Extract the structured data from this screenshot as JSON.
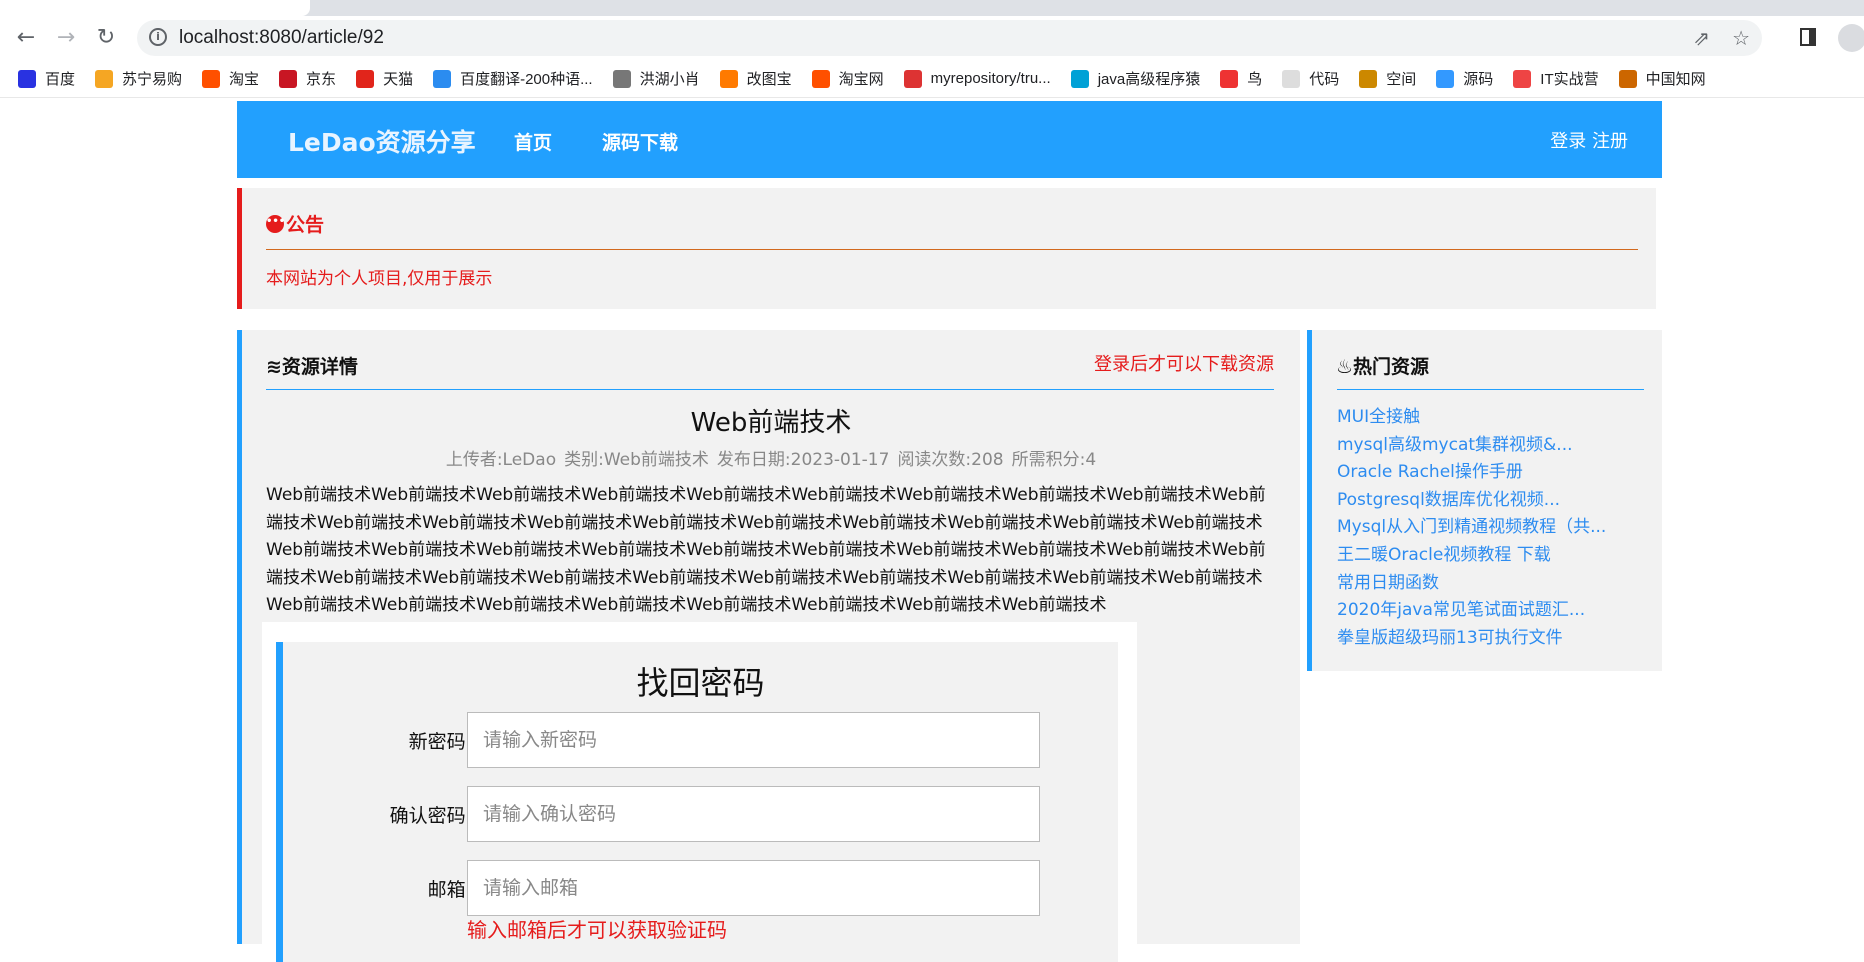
{
  "browser": {
    "url": "localhost:8080/article/92",
    "bookmarks": [
      "百度",
      "苏宁易购",
      "淘宝",
      "京东",
      "天猫",
      "百度翻译-200种语...",
      "洪湖小肖",
      "改图宝",
      "淘宝网",
      "myrepository/tru...",
      "java高级程序猿",
      "鸟",
      "代码",
      "空间",
      "源码",
      "IT实战营",
      "中国知网"
    ]
  },
  "header": {
    "logo": "LeDao资源分享",
    "nav": [
      "首页",
      "源码下载"
    ],
    "auth": "登录 注册"
  },
  "notice": {
    "title": "公告",
    "text": "本网站为个人项目,仅用于展示"
  },
  "article": {
    "section_title": "资源详情",
    "download_hint": "登录后才可以下载资源",
    "title": "Web前端技术",
    "meta": {
      "uploader": "上传者:LeDao",
      "category": "类别:Web前端技术",
      "date": "发布日期:2023-01-17",
      "views": "阅读次数:208",
      "points": "所需积分:4"
    },
    "body": "Web前端技术Web前端技术Web前端技术Web前端技术Web前端技术Web前端技术Web前端技术Web前端技术Web前端技术Web前端技术Web前端技术Web前端技术Web前端技术Web前端技术Web前端技术Web前端技术Web前端技术Web前端技术Web前端技术Web前端技术Web前端技术Web前端技术Web前端技术Web前端技术Web前端技术Web前端技术Web前端技术Web前端技术Web前端技术Web前端技术Web前端技术Web前端技术Web前端技术Web前端技术Web前端技术Web前端技术Web前端技术Web前端技术Web前端技术Web前端技术Web前端技术Web前端技术Web前端技术Web前端技术Web前端技术Web前端技术"
  },
  "reset_form": {
    "title": "找回密码",
    "fields": [
      {
        "label": "新密码:",
        "placeholder": "请输入新密码",
        "value": ""
      },
      {
        "label": "确认密码:",
        "placeholder": "请输入确认密码",
        "value": ""
      },
      {
        "label": "邮箱:",
        "placeholder": "请输入邮箱",
        "value": ""
      }
    ],
    "email_hint": "输入邮箱后才可以获取验证码"
  },
  "hot": {
    "title": "热门资源",
    "items": [
      "MUI全接触",
      "mysql高级mycat集群视频&...",
      "Oracle Rachel操作手册",
      "Postgresql数据库优化视频...",
      "Mysql从入门到精通视频教程（共...",
      "王二暖Oracle视频教程 下载",
      "常用日期函数",
      "2020年java常见笔试面试题汇...",
      "拳皇版超级玛丽13可执行文件"
    ]
  },
  "colors": {
    "brand": "#22a0fe",
    "alert": "#e51c1c",
    "link": "#2d8cf0"
  }
}
